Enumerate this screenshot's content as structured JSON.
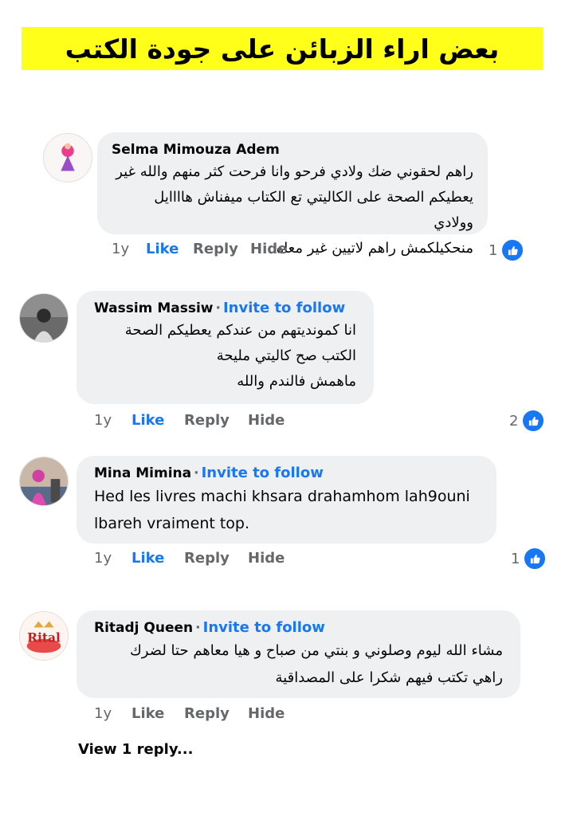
{
  "banner": {
    "title": "بعض اراء الزبائن على جودة الكتب"
  },
  "comments": [
    {
      "author": "Selma Mimouza Adem",
      "invite": "",
      "lines": [
        "راهم لحقوني ضك ولادي فرحو وانا فرحت كثر منهم والله غير",
        "يعطيكم الصحة على الكاليتي تع الكتاب ميفناش هاااايل وولادي",
        "منحكيلكمش راهم لاتيين غير معاه"
      ],
      "time": "1y",
      "like": "Like",
      "reply": "Reply",
      "hide": "Hide",
      "reactions": "1",
      "liked": true,
      "avatar_icon": "avatar-selma"
    },
    {
      "author": "Wassim Massiw",
      "invite": "Invite to follow",
      "lines": [
        "انا كمونديتهم من عندكم يعطيكم الصحة",
        "الكتب صح كاليتي مليحة",
        "ماهمش فالندم والله"
      ],
      "time": "1y",
      "like": "Like",
      "reply": "Reply",
      "hide": "Hide",
      "reactions": "2",
      "liked": true,
      "avatar_icon": "avatar-wassim"
    },
    {
      "author": "Mina Mimina",
      "invite": "Invite to follow",
      "lines": [
        "Hed les livres machi khsara drahamhom lah9ouni",
        "lbareh vraiment top."
      ],
      "time": "1y",
      "like": "Like",
      "reply": "Reply",
      "hide": "Hide",
      "reactions": "1",
      "liked": true,
      "avatar_icon": "avatar-mina"
    },
    {
      "author": "Ritadj Queen",
      "invite": "Invite to follow",
      "lines": [
        "مشاء الله ليوم وصلوني و بنتي من صباح و هيا معاهم حتا لضرك",
        "راهي تكتب فيهم شكرا على المصداقية"
      ],
      "time": "1y",
      "like": "Like",
      "reply": "Reply",
      "hide": "Hide",
      "reactions": "",
      "liked": false,
      "avatar_icon": "avatar-ritadj"
    }
  ],
  "view_replies": "View 1 reply...",
  "colors": {
    "banner": "#ffff1a",
    "bubble": "#eff0f2",
    "accent": "#1877f2",
    "muted": "#65676b"
  }
}
